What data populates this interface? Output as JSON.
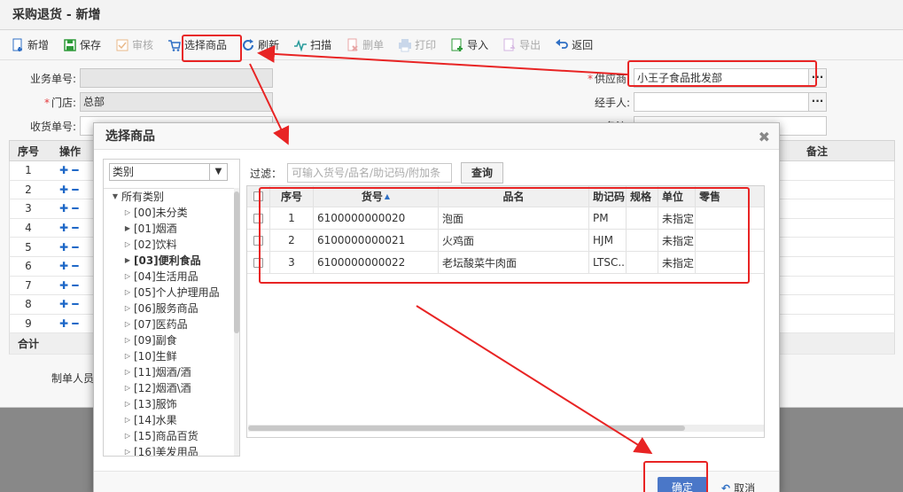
{
  "page": {
    "title": "采购退货 - 新增"
  },
  "toolbar": [
    {
      "label": "新增",
      "icon": "new-doc-icon",
      "disabled": false
    },
    {
      "label": "保存",
      "icon": "save-icon",
      "disabled": false
    },
    {
      "label": "审核",
      "icon": "audit-icon",
      "disabled": true
    },
    {
      "label": "选择商品",
      "icon": "cart-icon",
      "disabled": false
    },
    {
      "label": "刷新",
      "icon": "refresh-icon",
      "disabled": false
    },
    {
      "label": "扫描",
      "icon": "scan-icon",
      "disabled": false
    },
    {
      "label": "删单",
      "icon": "delete-icon",
      "disabled": true
    },
    {
      "label": "打印",
      "icon": "print-icon",
      "disabled": true
    },
    {
      "label": "导入",
      "icon": "import-icon",
      "disabled": false
    },
    {
      "label": "导出",
      "icon": "export-icon",
      "disabled": true
    },
    {
      "label": "返回",
      "icon": "back-icon",
      "disabled": false
    }
  ],
  "form": {
    "business_no_label": "业务单号:",
    "store_label": "门店:",
    "store_value": "总部",
    "receive_no_label": "收货单号:",
    "supplier_label": "供应商:",
    "supplier_value": "小王子食品批发部",
    "handler_label": "经手人:",
    "remark_label": "备注:",
    "maker_label": "制单人员:"
  },
  "grid": {
    "headers": {
      "seq": "序号",
      "op": "操作",
      "remark": "备注"
    },
    "rows": [
      "1",
      "2",
      "3",
      "4",
      "5",
      "6",
      "7",
      "8",
      "9"
    ],
    "total_label": "合计"
  },
  "dialog": {
    "title": "选择商品",
    "category_select": "类别",
    "tree": [
      {
        "label": "所有类别",
        "level": 0,
        "expanded": true,
        "bold": false
      },
      {
        "label": "[00]未分类",
        "level": 1,
        "bold": false
      },
      {
        "label": "[01]烟酒",
        "level": 1,
        "bold": false,
        "solid": true
      },
      {
        "label": "[02]饮料",
        "level": 1,
        "bold": false
      },
      {
        "label": "[03]便利食品",
        "level": 1,
        "bold": true,
        "solid": true
      },
      {
        "label": "[04]生活用品",
        "level": 1,
        "bold": false
      },
      {
        "label": "[05]个人护理用品",
        "level": 1,
        "bold": false
      },
      {
        "label": "[06]服务商品",
        "level": 1,
        "bold": false
      },
      {
        "label": "[07]医药品",
        "level": 1,
        "bold": false
      },
      {
        "label": "[09]副食",
        "level": 1,
        "bold": false
      },
      {
        "label": "[10]生鲜",
        "level": 1,
        "bold": false
      },
      {
        "label": "[11]烟酒/酒",
        "level": 1,
        "bold": false
      },
      {
        "label": "[12]烟酒\\酒",
        "level": 1,
        "bold": false
      },
      {
        "label": "[13]服饰",
        "level": 1,
        "bold": false
      },
      {
        "label": "[14]水果",
        "level": 1,
        "bold": false
      },
      {
        "label": "[15]商品百货",
        "level": 1,
        "bold": false
      },
      {
        "label": "[16]美发用品",
        "level": 1,
        "bold": false
      }
    ],
    "filter_label": "过滤：",
    "filter_placeholder": "可输入货号/品名/助记码/附加条码",
    "query_button": "查询",
    "columns": {
      "seq": "序号",
      "code": "货号",
      "name": "品名",
      "memo": "助记码",
      "spec": "规格",
      "unit": "单位",
      "price": "零售"
    },
    "products": [
      {
        "seq": "1",
        "code": "6100000000020",
        "name": "泡面",
        "memo": "PM",
        "spec": "",
        "unit": "未指定"
      },
      {
        "seq": "2",
        "code": "6100000000021",
        "name": "火鸡面",
        "memo": "HJM",
        "spec": "",
        "unit": "未指定"
      },
      {
        "seq": "3",
        "code": "6100000000022",
        "name": "老坛酸菜牛肉面",
        "memo": "LTSC...",
        "spec": "",
        "unit": "未指定"
      }
    ],
    "ok_button": "确定",
    "cancel_button": "取消"
  },
  "colors": {
    "highlight": "#e82424",
    "primary": "#4a77c8"
  }
}
